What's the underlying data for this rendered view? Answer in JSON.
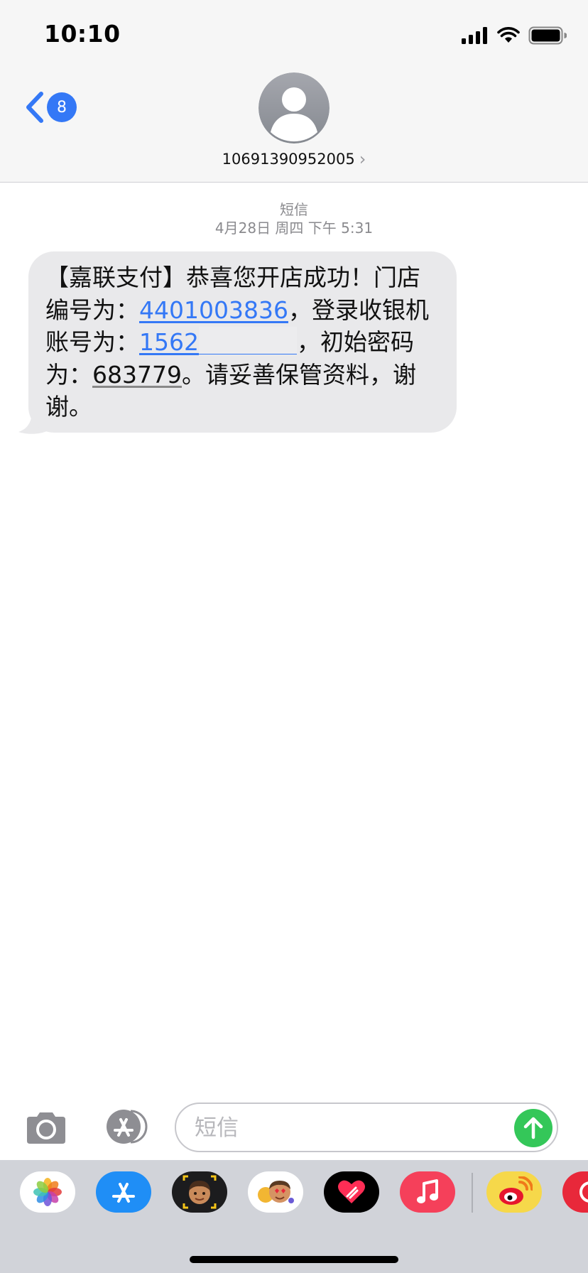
{
  "status_bar": {
    "time": "10:10"
  },
  "nav": {
    "back_badge": "8",
    "contact_number": "10691390952005",
    "contact_chevron": "›"
  },
  "thread": {
    "service": "短信",
    "timestamp": "4月28日 周四 下午 5:31",
    "message": {
      "part1": "【嘉联支付】恭喜您开店成功！门店编号为：",
      "store_number": "4401003836",
      "part2": "，登录收银机账号为：",
      "account_prefix": "1562",
      "part3": "，初始密码为：",
      "password": "683779",
      "part4": "。请妥善保管资料，谢谢。"
    }
  },
  "composer": {
    "placeholder": "短信"
  },
  "icons": {
    "back": "chevron-left-icon",
    "avatar": "person-avatar-icon",
    "camera": "camera-icon",
    "appstore": "app-store-icon",
    "send": "arrow-up-icon"
  },
  "app_tray": [
    "photos-icon",
    "app-store-icon",
    "memoji-stickers-icon",
    "animoji-icon",
    "digital-touch-icon",
    "music-icon",
    "weibo-icon",
    "partial-app-icon"
  ],
  "colors": {
    "accent": "#3478f6",
    "send": "#34c759",
    "bubble": "#e9e9eb",
    "tray": "#d1d3d9"
  }
}
